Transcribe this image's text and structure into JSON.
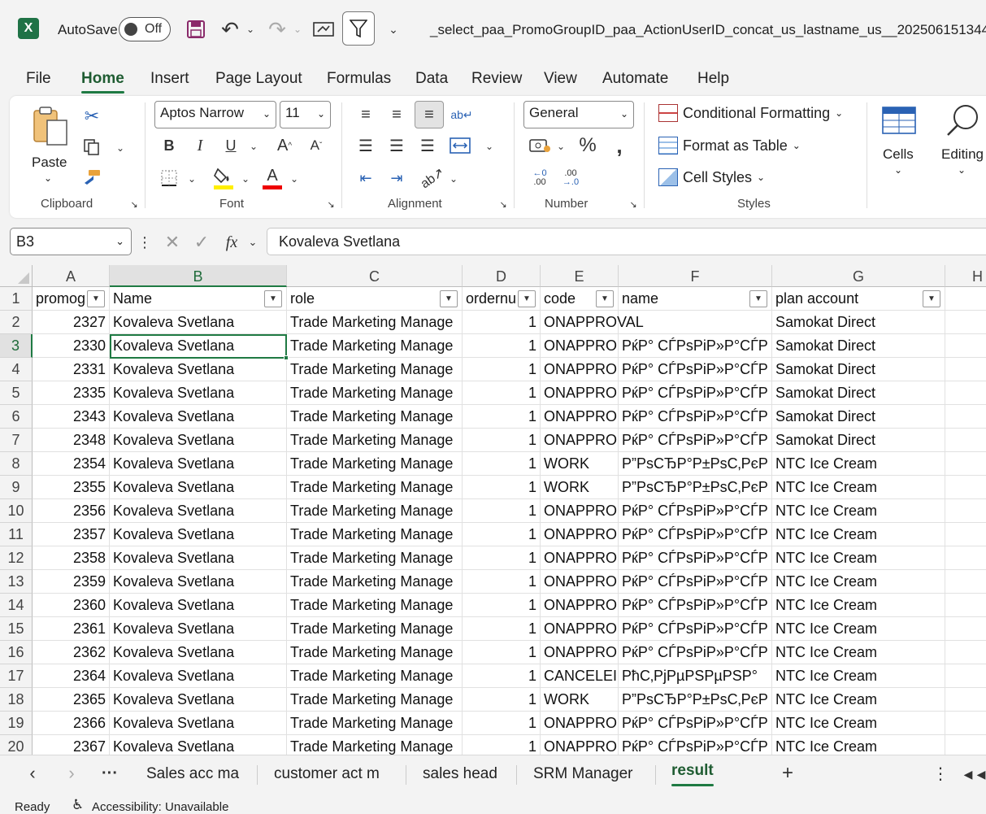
{
  "titlebar": {
    "autosave_label": "AutoSave",
    "autosave_state": "Off",
    "file_name": "_select_paa_PromoGroupID_paa_ActionUserID_concat_us_lastname_us__202506151344"
  },
  "menu": [
    "File",
    "Home",
    "Insert",
    "Page Layout",
    "Formulas",
    "Data",
    "Review",
    "View",
    "Automate",
    "Help"
  ],
  "ribbon": {
    "clipboard": {
      "paste_label": "Paste",
      "group_label": "Clipboard"
    },
    "font": {
      "font_name": "Aptos Narrow",
      "font_size": "11",
      "group_label": "Font"
    },
    "alignment": {
      "group_label": "Alignment"
    },
    "number": {
      "format": "General",
      "group_label": "Number"
    },
    "styles": {
      "conditional_formatting": "Conditional Formatting",
      "format_as_table": "Format as Table",
      "cell_styles": "Cell Styles",
      "group_label": "Styles"
    },
    "cells_label": "Cells",
    "editing_label": "Editing"
  },
  "formula_bar": {
    "name_box": "B3",
    "formula": "Kovaleva Svetlana"
  },
  "columns": [
    "A",
    "B",
    "C",
    "D",
    "E",
    "F",
    "G",
    "H"
  ],
  "headers": [
    "promog",
    "Name",
    "role",
    "ordernu",
    "code",
    "name",
    "plan account"
  ],
  "rows": [
    {
      "n": "1"
    },
    {
      "n": "2",
      "a": "2327",
      "b": "Kovaleva Svetlana",
      "c": "Trade Marketing Manage",
      "d": "1",
      "e": "ONAPPROVAL",
      "f": "",
      "g": "Samokat Direct"
    },
    {
      "n": "3",
      "a": "2330",
      "b": "Kovaleva Svetlana",
      "c": "Trade Marketing Manage",
      "d": "1",
      "e": "ONAPPRO",
      "f": "PќP° CЃPsPiP»P°CЃP",
      "g": "Samokat Direct"
    },
    {
      "n": "4",
      "a": "2331",
      "b": "Kovaleva Svetlana",
      "c": "Trade Marketing Manage",
      "d": "1",
      "e": "ONAPPRO",
      "f": "PќP° CЃPsPiP»P°CЃP",
      "g": "Samokat Direct"
    },
    {
      "n": "5",
      "a": "2335",
      "b": "Kovaleva Svetlana",
      "c": "Trade Marketing Manage",
      "d": "1",
      "e": "ONAPPRO",
      "f": "PќP° CЃPsPiP»P°CЃP",
      "g": "Samokat Direct"
    },
    {
      "n": "6",
      "a": "2343",
      "b": "Kovaleva Svetlana",
      "c": "Trade Marketing Manage",
      "d": "1",
      "e": "ONAPPRO",
      "f": "PќP° CЃPsPiP»P°CЃP",
      "g": "Samokat Direct"
    },
    {
      "n": "7",
      "a": "2348",
      "b": "Kovaleva Svetlana",
      "c": "Trade Marketing Manage",
      "d": "1",
      "e": "ONAPPRO",
      "f": "PќP° CЃPsPiP»P°CЃP",
      "g": "Samokat Direct"
    },
    {
      "n": "8",
      "a": "2354",
      "b": "Kovaleva Svetlana",
      "c": "Trade Marketing Manage",
      "d": "1",
      "e": "WORK",
      "f": "P”PsCЂP°P±PsC‚PєP",
      "g": "NTC Ice Cream"
    },
    {
      "n": "9",
      "a": "2355",
      "b": "Kovaleva Svetlana",
      "c": "Trade Marketing Manage",
      "d": "1",
      "e": "WORK",
      "f": "P”PsCЂP°P±PsC‚PєP",
      "g": "NTC Ice Cream"
    },
    {
      "n": "10",
      "a": "2356",
      "b": "Kovaleva Svetlana",
      "c": "Trade Marketing Manage",
      "d": "1",
      "e": "ONAPPRO",
      "f": "PќP° CЃPsPiP»P°CЃP",
      "g": "NTC Ice Cream"
    },
    {
      "n": "11",
      "a": "2357",
      "b": "Kovaleva Svetlana",
      "c": "Trade Marketing Manage",
      "d": "1",
      "e": "ONAPPRO",
      "f": "PќP° CЃPsPiP»P°CЃP",
      "g": "NTC Ice Cream"
    },
    {
      "n": "12",
      "a": "2358",
      "b": "Kovaleva Svetlana",
      "c": "Trade Marketing Manage",
      "d": "1",
      "e": "ONAPPRO",
      "f": "PќP° CЃPsPiP»P°CЃP",
      "g": "NTC Ice Cream"
    },
    {
      "n": "13",
      "a": "2359",
      "b": "Kovaleva Svetlana",
      "c": "Trade Marketing Manage",
      "d": "1",
      "e": "ONAPPRO",
      "f": "PќP° CЃPsPiP»P°CЃP",
      "g": "NTC Ice Cream"
    },
    {
      "n": "14",
      "a": "2360",
      "b": "Kovaleva Svetlana",
      "c": "Trade Marketing Manage",
      "d": "1",
      "e": "ONAPPRO",
      "f": "PќP° CЃPsPiP»P°CЃP",
      "g": "NTC Ice Cream"
    },
    {
      "n": "15",
      "a": "2361",
      "b": "Kovaleva Svetlana",
      "c": "Trade Marketing Manage",
      "d": "1",
      "e": "ONAPPRO",
      "f": "PќP° CЃPsPiP»P°CЃP",
      "g": "NTC Ice Cream"
    },
    {
      "n": "16",
      "a": "2362",
      "b": "Kovaleva Svetlana",
      "c": "Trade Marketing Manage",
      "d": "1",
      "e": "ONAPPRO",
      "f": "PќP° CЃPsPiP»P°CЃP",
      "g": "NTC Ice Cream"
    },
    {
      "n": "17",
      "a": "2364",
      "b": "Kovaleva Svetlana",
      "c": "Trade Marketing Manage",
      "d": "1",
      "e": "CANCELEI",
      "f": "PћC‚PjPµPSPµPSP°",
      "g": "NTC Ice Cream"
    },
    {
      "n": "18",
      "a": "2365",
      "b": "Kovaleva Svetlana",
      "c": "Trade Marketing Manage",
      "d": "1",
      "e": "WORK",
      "f": "P”PsCЂP°P±PsC‚PєP",
      "g": "NTC Ice Cream"
    },
    {
      "n": "19",
      "a": "2366",
      "b": "Kovaleva Svetlana",
      "c": "Trade Marketing Manage",
      "d": "1",
      "e": "ONAPPRO",
      "f": "PќP° CЃPsPiP»P°CЃP",
      "g": "NTC Ice Cream"
    },
    {
      "n": "20",
      "a": "2367",
      "b": "Kovaleva Svetlana",
      "c": "Trade Marketing Manage",
      "d": "1",
      "e": "ONAPPRO",
      "f": "PќP° CЃPsPiP»P°CЃP",
      "g": "NTC Ice Cream"
    }
  ],
  "sheet_tabs": [
    "Sales acc ma",
    "customer act m",
    "sales head",
    "SRM Manager",
    "result"
  ],
  "active_sheet": "result",
  "status": {
    "ready": "Ready",
    "accessibility": "Accessibility: Unavailable"
  },
  "colors": {
    "accent": "#1f7a43",
    "excel_icon": "#1f7246"
  }
}
